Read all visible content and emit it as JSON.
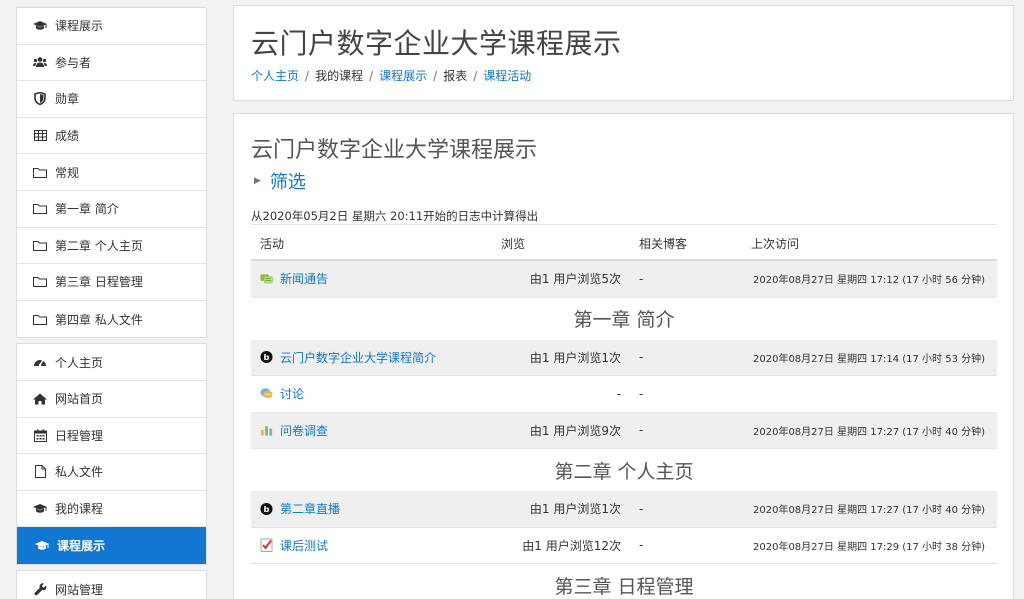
{
  "sidebar": {
    "block1": [
      {
        "label": "课程展示",
        "icon": "graduation-cap-icon"
      },
      {
        "label": "参与者",
        "icon": "users-icon"
      },
      {
        "label": "勋章",
        "icon": "shield-icon"
      },
      {
        "label": "成绩",
        "icon": "table-icon"
      },
      {
        "label": "常规",
        "icon": "folder-icon"
      },
      {
        "label": "第一章 简介",
        "icon": "folder-icon"
      },
      {
        "label": "第二章 个人主页",
        "icon": "folder-icon"
      },
      {
        "label": "第三章 日程管理",
        "icon": "folder-icon"
      },
      {
        "label": "第四章 私人文件",
        "icon": "folder-icon"
      }
    ],
    "block2": [
      {
        "label": "个人主页",
        "icon": "dashboard-icon"
      },
      {
        "label": "网站首页",
        "icon": "home-icon"
      },
      {
        "label": "日程管理",
        "icon": "calendar-icon"
      },
      {
        "label": "私人文件",
        "icon": "file-icon"
      },
      {
        "label": "我的课程",
        "icon": "graduation-cap-icon"
      },
      {
        "label": "课程展示",
        "icon": "graduation-cap-icon",
        "active": true
      }
    ],
    "block3": [
      {
        "label": "网站管理",
        "icon": "wrench-icon"
      }
    ]
  },
  "header": {
    "title": "云门户数字企业大学课程展示",
    "breadcrumb": [
      {
        "label": "个人主页",
        "link": true
      },
      {
        "label": "我的课程",
        "link": false
      },
      {
        "label": "课程展示",
        "link": true
      },
      {
        "label": "报表",
        "link": false
      },
      {
        "label": "课程活动",
        "link": true
      }
    ]
  },
  "report": {
    "title": "云门户数字企业大学课程展示",
    "filter_label": "筛选",
    "log_line": "从2020年05月2日 星期六 20:11开始的日志中计算得出",
    "columns": {
      "activity": "活动",
      "views": "浏览",
      "blogs": "相关博客",
      "last_access": "上次访问"
    },
    "rows": [
      {
        "type": "row",
        "icon": "forum-news-icon",
        "activity": "新闻通告",
        "views": "由1 用户浏览5次",
        "blogs": "-",
        "last_access": "2020年08月27日 星期四 17:12 (17 小时 56 分钟)"
      },
      {
        "type": "section",
        "label": "第一章 简介"
      },
      {
        "type": "row",
        "icon": "bigbluebutton-icon",
        "activity": "云门户数字企业大学课程简介",
        "views": "由1 用户浏览1次",
        "blogs": "-",
        "last_access": "2020年08月27日 星期四 17:14 (17 小时 53 分钟)"
      },
      {
        "type": "row",
        "icon": "forum-icon",
        "activity": "讨论",
        "views": "-",
        "blogs": "-",
        "last_access": ""
      },
      {
        "type": "row",
        "icon": "feedback-icon",
        "activity": "问卷调查",
        "views": "由1 用户浏览9次",
        "blogs": "-",
        "last_access": "2020年08月27日 星期四 17:27 (17 小时 40 分钟)"
      },
      {
        "type": "section",
        "label": "第二章 个人主页"
      },
      {
        "type": "row",
        "icon": "bigbluebutton-icon",
        "activity": "第二章直播",
        "views": "由1 用户浏览1次",
        "blogs": "-",
        "last_access": "2020年08月27日 星期四 17:27 (17 小时 40 分钟)"
      },
      {
        "type": "row",
        "icon": "quiz-icon",
        "activity": "课后测试",
        "views": "由1 用户浏览12次",
        "blogs": "-",
        "last_access": "2020年08月27日 星期四 17:29 (17 小时 38 分钟)"
      },
      {
        "type": "section",
        "label": "第三章 日程管理"
      }
    ]
  }
}
